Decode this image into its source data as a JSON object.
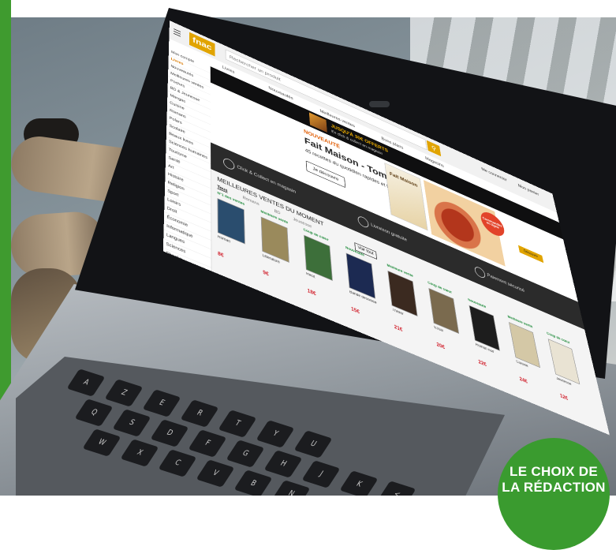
{
  "site": {
    "logo": "fnac",
    "search_placeholder": "Rechercher un produit",
    "header_links": [
      "Me connecter",
      "Mon panier"
    ],
    "nav_items": [
      "Livres",
      "Nouveautés",
      "Meilleures ventes",
      "Bons plans",
      "Magasins"
    ]
  },
  "sidebar": {
    "items": [
      "Mon compte",
      "Livres",
      "Nouveautés",
      "Meilleures ventes",
      "Poches",
      "BD & Jeunesse",
      "Mangas",
      "Cuisine",
      "Romans",
      "Polars",
      "Scolaire",
      "Beaux livres",
      "Sciences humaines",
      "Tourisme",
      "Santé",
      "Art",
      "Histoire",
      "Religion",
      "Sport",
      "Loisirs",
      "Droit",
      "Économie",
      "Informatique",
      "Langues",
      "Sciences",
      "Ebooks"
    ]
  },
  "promo": {
    "title": "JUSQU'À 30€ OFFERTS",
    "subtitle": "En click & collect en magasin"
  },
  "hero": {
    "badge": "NOUVEAUTÉ",
    "title": "Fait Maison - Tome 7",
    "subtitle": "45 recettes du quotidien rapides et faciles",
    "button": "Je découvre",
    "book_title": "Fait Maison",
    "sticker": "Commandez en ligne",
    "cta": "Découvrir"
  },
  "services": [
    "Click & Collect en magasin",
    "Livraison gratuite",
    "Paiement sécurisé"
  ],
  "shelf": {
    "title": "MEILLEURES VENTES DU MOMENT",
    "tabs": [
      "Tous",
      "Romans",
      "BD",
      "Jeunesse"
    ],
    "more_button": "Voir tout",
    "books": [
      {
        "label": "N°1 des ventes",
        "title": "Roman",
        "price": "8€",
        "cover": "#2a4d6e"
      },
      {
        "label": "Meilleure vente",
        "title": "Littérature",
        "price": "9€",
        "cover": "#9a8a5c"
      },
      {
        "label": "Coup de cœur",
        "title": "Récit",
        "price": "18€",
        "cover": "#3d6f3a"
      },
      {
        "label": "Nouveauté",
        "title": "Bande dessinée",
        "price": "15€",
        "cover": "#1c2a52"
      },
      {
        "label": "Meilleure vente",
        "title": "Thriller",
        "price": "21€",
        "cover": "#3b2a20"
      },
      {
        "label": "Coup de cœur",
        "title": "Essai",
        "price": "20€",
        "cover": "#7a6a4e"
      },
      {
        "label": "Nouveauté",
        "title": "Roman noir",
        "price": "22€",
        "cover": "#1d1d1d"
      },
      {
        "label": "Meilleure vente",
        "title": "Cuisine",
        "price": "24€",
        "cover": "#d4c8a6"
      },
      {
        "label": "Coup de cœur",
        "title": "Jeunesse",
        "price": "12€",
        "cover": "#e9e3d3"
      }
    ]
  },
  "keys": [
    "A",
    "Z",
    "E",
    "R",
    "T",
    "Y",
    "U",
    "Q",
    "S",
    "D",
    "F",
    "G",
    "H",
    "J",
    "K",
    "<",
    "W",
    "X",
    "C",
    "V",
    "B",
    "N"
  ],
  "badge": {
    "line1": "LE CHOIX DE",
    "line2": "LA RÉDACTION"
  }
}
